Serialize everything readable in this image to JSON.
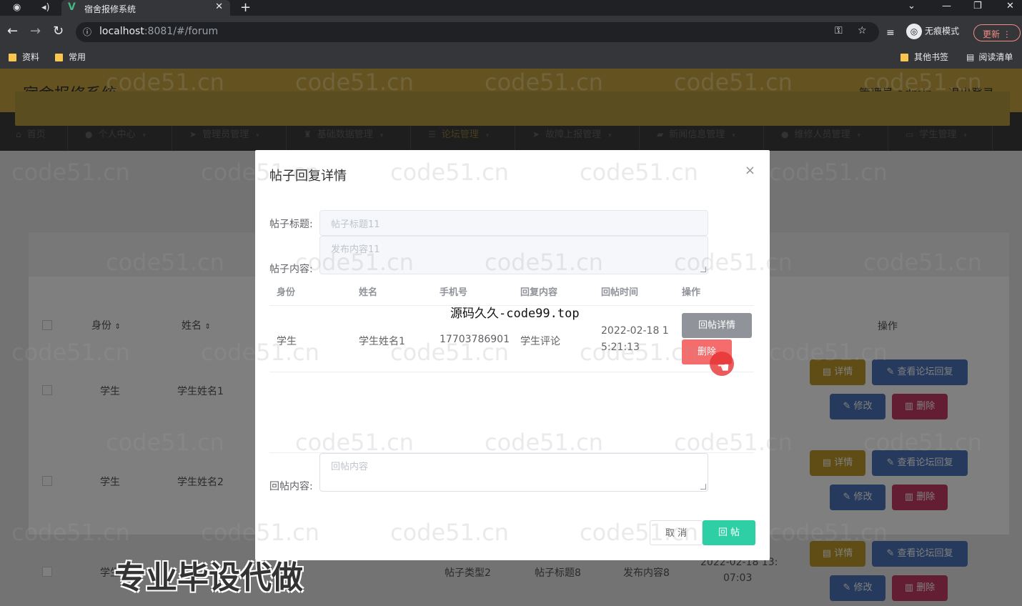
{
  "browser": {
    "tab_title": "宿舍报修系统",
    "url_host": "localhost",
    "url_rest": ":8081/#/forum",
    "incognito_label": "无痕模式",
    "update_label": "更新",
    "bookmarks": [
      "资料",
      "常用"
    ],
    "bookmarks_right": [
      "其他书签",
      "阅读清单"
    ]
  },
  "header": {
    "brand": "宿舍报修系统",
    "user": "管理员 admin",
    "logout": "退出登录"
  },
  "nav": [
    {
      "label": "首页",
      "icon": "home-icon"
    },
    {
      "label": "个人中心",
      "icon": "user-icon"
    },
    {
      "label": "管理员管理",
      "icon": "send-icon"
    },
    {
      "label": "基础数据管理",
      "icon": "trophy-icon"
    },
    {
      "label": "论坛管理",
      "icon": "list-icon"
    },
    {
      "label": "故障上报管理",
      "icon": "send-icon"
    },
    {
      "label": "新闻信息管理",
      "icon": "news-icon"
    },
    {
      "label": "维修人员管理",
      "icon": "people-icon"
    },
    {
      "label": "学生管理",
      "icon": "id-icon"
    }
  ],
  "background_table": {
    "headers": {
      "identity": "身份",
      "name": "姓名",
      "ops": "操作"
    },
    "rows": [
      {
        "identity": "学生",
        "name": "学生姓名1"
      },
      {
        "identity": "学生",
        "name": "学生姓名2"
      },
      {
        "identity": "学生",
        "type": "帖子类型2",
        "title": "帖子标题8",
        "content": "发布内容8",
        "time_partial": "2022-02-18 13:",
        "time_rest": "07:03"
      }
    ],
    "buttons": {
      "detail": "详情",
      "view_reply": "查看论坛回复",
      "edit": "修改",
      "delete": "删除"
    }
  },
  "modal": {
    "title": "帖子回复详情",
    "close": "×",
    "post_title_label": "帖子标题:",
    "post_title_value": "帖子标题11",
    "post_content_label": "帖子内容:",
    "post_content_value": "发布内容11",
    "table": {
      "headers": [
        "身份",
        "姓名",
        "手机号",
        "回复内容",
        "回帖时间",
        "操作"
      ],
      "rows": [
        {
          "identity": "学生",
          "name": "学生姓名1",
          "phone": "17703786901",
          "content": "学生评论",
          "time1": "2022-02-18 1",
          "time2": "5:21:13"
        }
      ],
      "btn_detail": "回帖详情",
      "btn_delete": "删除"
    },
    "reply_label": "回帖内容:",
    "reply_placeholder": "回帖内容",
    "cancel": "取 消",
    "submit": "回 帖"
  },
  "watermark": "code51.cn",
  "overlay_text": "源码久久-code99.top",
  "promo_text": "专业毕设代做"
}
